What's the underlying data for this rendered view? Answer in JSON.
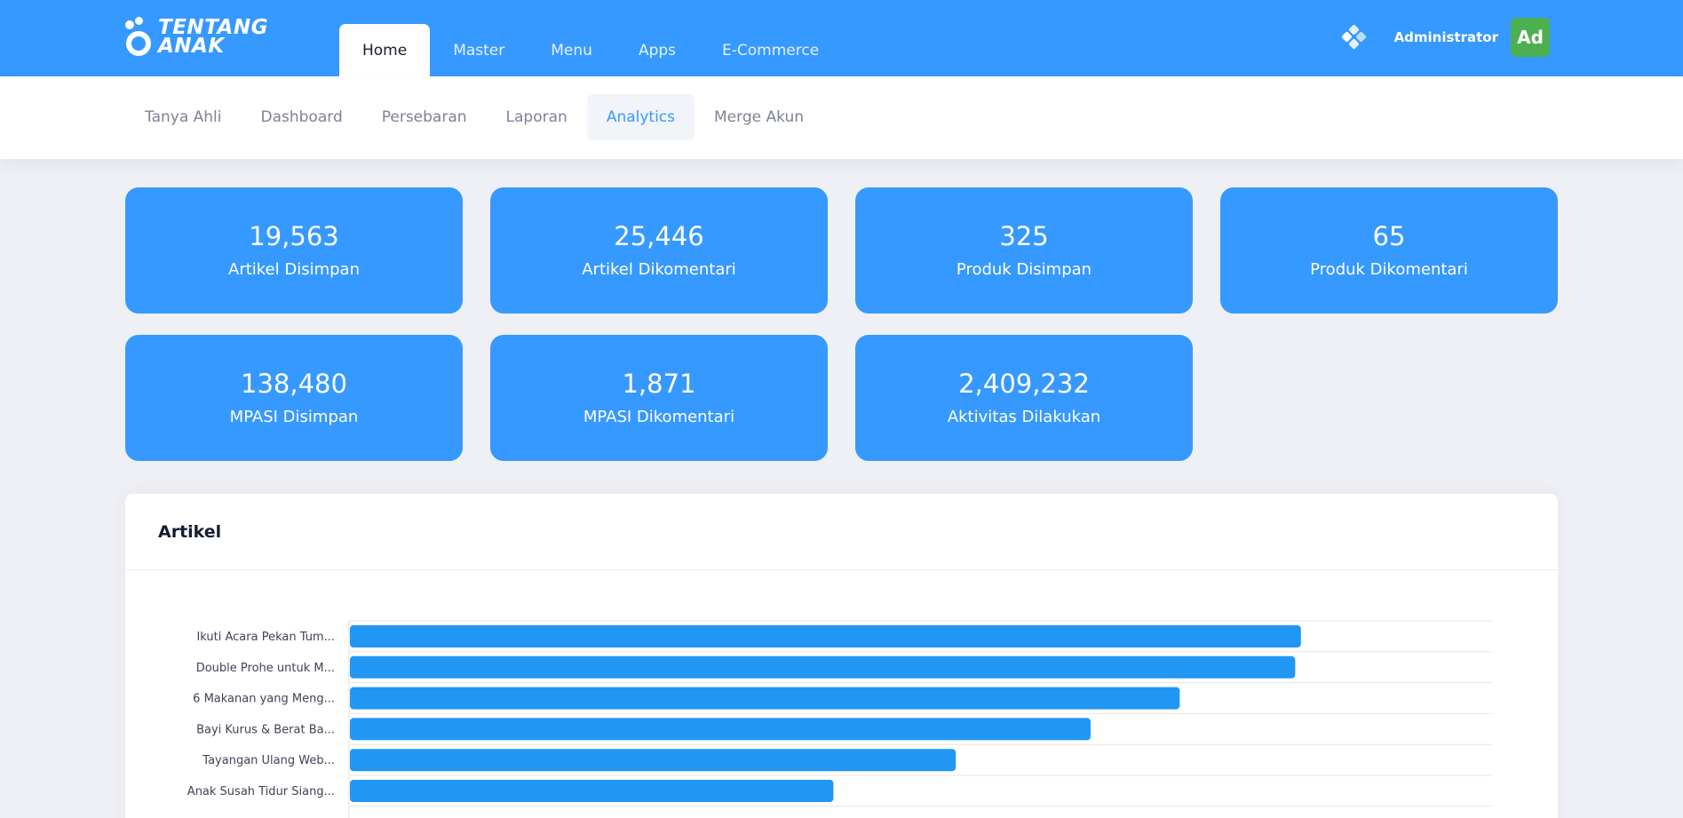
{
  "brand": {
    "line1": "TENTANG",
    "line2": "ANAK"
  },
  "main_nav": [
    {
      "label": "Home",
      "active": true
    },
    {
      "label": "Master",
      "active": false
    },
    {
      "label": "Menu",
      "active": false
    },
    {
      "label": "Apps",
      "active": false
    },
    {
      "label": "E-Commerce",
      "active": false
    }
  ],
  "user": {
    "name": "Administrator",
    "initials": "Ad",
    "avatar_color": "#4caf50"
  },
  "sub_nav": [
    {
      "label": "Tanya Ahli",
      "active": false
    },
    {
      "label": "Dashboard",
      "active": false
    },
    {
      "label": "Persebaran",
      "active": false
    },
    {
      "label": "Laporan",
      "active": false
    },
    {
      "label": "Analytics",
      "active": true
    },
    {
      "label": "Merge Akun",
      "active": false
    }
  ],
  "stats": [
    {
      "value": "19,563",
      "label": "Artikel Disimpan"
    },
    {
      "value": "25,446",
      "label": "Artikel Dikomentari"
    },
    {
      "value": "325",
      "label": "Produk Disimpan"
    },
    {
      "value": "65",
      "label": "Produk Dikomentari"
    },
    {
      "value": "138,480",
      "label": "MPASI Disimpan"
    },
    {
      "value": "1,871",
      "label": "MPASI Dikomentari"
    },
    {
      "value": "2,409,232",
      "label": "Aktivitas Dilakukan"
    }
  ],
  "artikel_panel": {
    "title": "Artikel"
  },
  "colors": {
    "primary": "#3699ff",
    "bar": "#2196f3",
    "background": "#eef0f5"
  },
  "icons": {
    "apps": "grid-diamond-icon"
  },
  "chart_data": {
    "type": "bar",
    "orientation": "horizontal",
    "categories": [
      "Ikuti Acara Pekan Tum...",
      "Double Prohe untuk M...",
      "6 Makanan yang Meng...",
      "Bayi Kurus & Berat Ba...",
      "Tayangan Ulang Web...",
      "Anak Susah Tidur Siang..."
    ],
    "values": [
      832,
      827,
      726,
      648,
      530,
      423
    ],
    "xlim": [
      0,
      1000
    ],
    "grid": true
  }
}
